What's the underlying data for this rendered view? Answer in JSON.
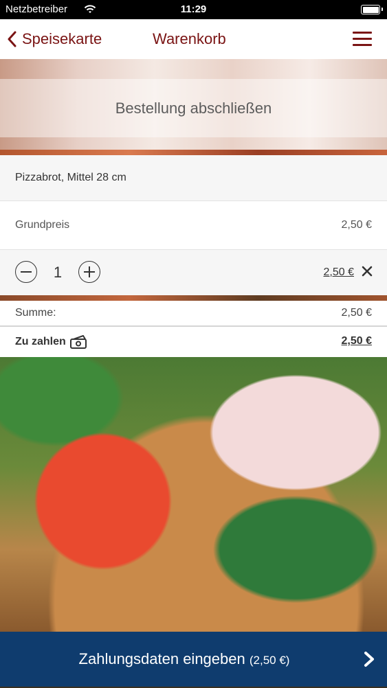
{
  "status_bar": {
    "carrier": "Netzbetreiber",
    "time": "11:29"
  },
  "nav": {
    "back_label": "Speisekarte",
    "title": "Warenkorb"
  },
  "banner": {
    "title": "Bestellung abschließen"
  },
  "cart": {
    "item_name": "Pizzabrot, Mittel 28 cm",
    "base_label": "Grundpreis",
    "base_price": "2,50 €",
    "quantity": "1",
    "line_total": "2,50 €"
  },
  "summary": {
    "sum_label": "Summe:",
    "sum_value": "2,50 €",
    "pay_label": "Zu zahlen",
    "pay_value": "2,50 €"
  },
  "cta": {
    "label": "Zahlungsdaten eingeben",
    "amount": "(2,50 €)"
  },
  "colors": {
    "brand": "#7a1414",
    "cta": "#0f3c6e"
  }
}
